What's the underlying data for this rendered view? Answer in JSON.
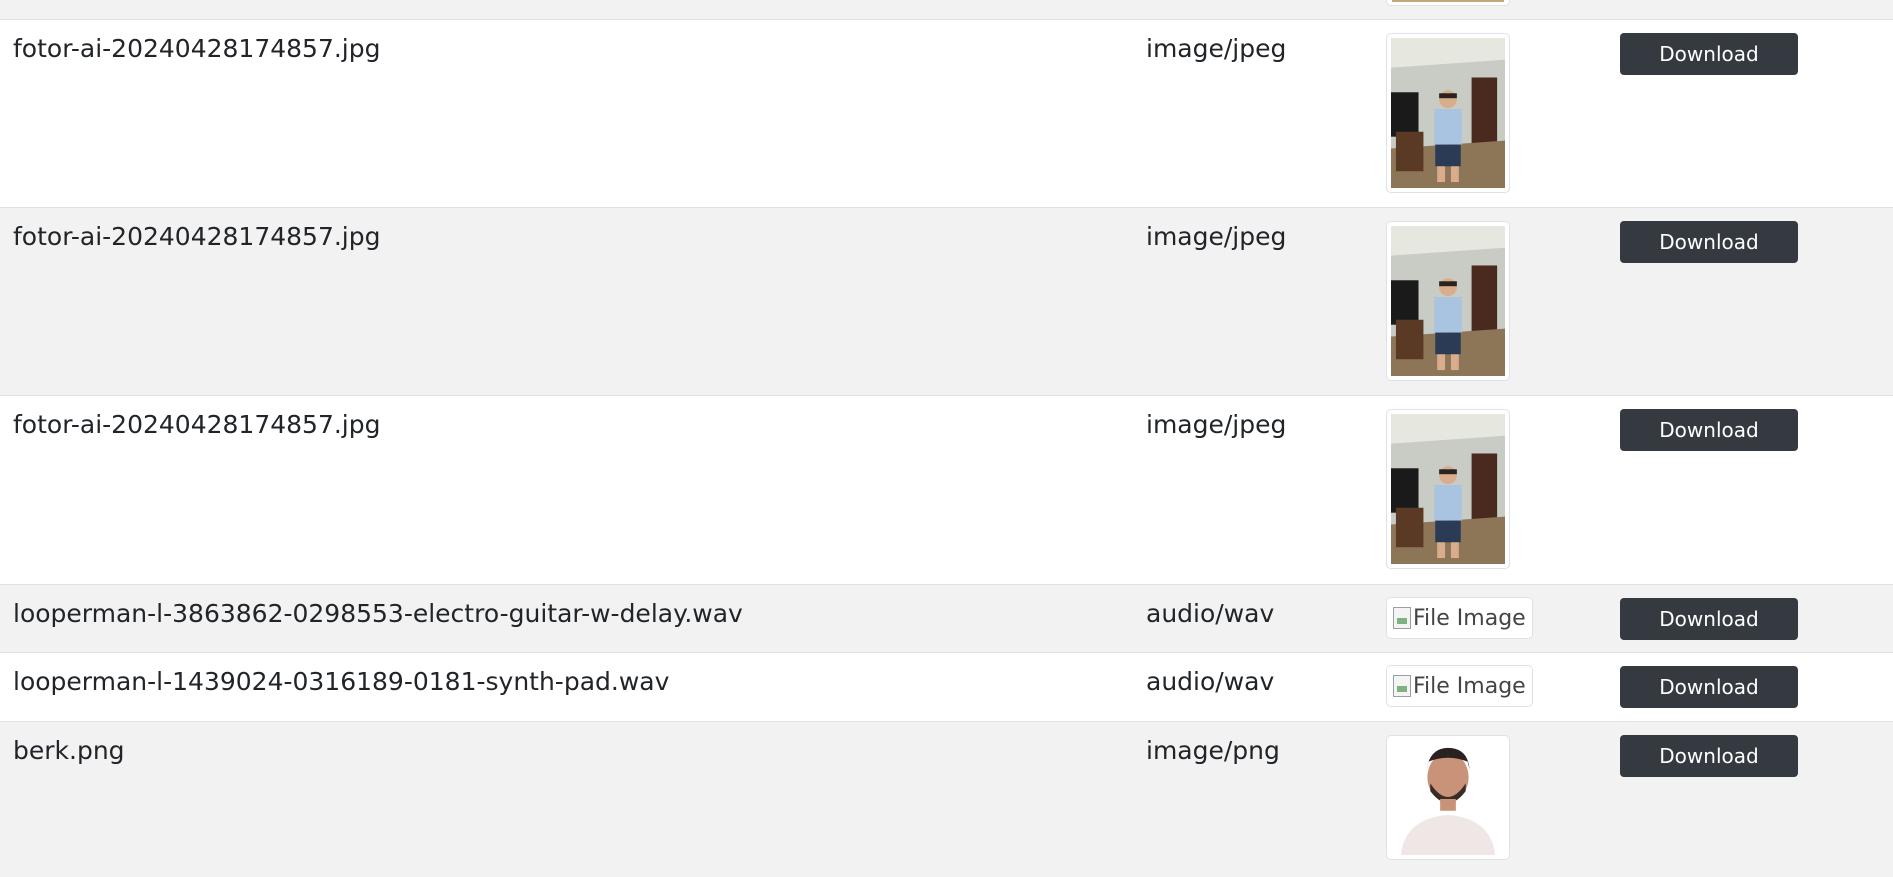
{
  "files": [
    {
      "name": "fotor-ai-20240428174857.jpg",
      "type": "image/jpeg",
      "preview": "photo",
      "preview_alt": "",
      "button": "Download"
    },
    {
      "name": "fotor-ai-20240428174857.jpg",
      "type": "image/jpeg",
      "preview": "photo",
      "preview_alt": "",
      "button": "Download"
    },
    {
      "name": "fotor-ai-20240428174857.jpg",
      "type": "image/jpeg",
      "preview": "photo",
      "preview_alt": "",
      "button": "Download"
    },
    {
      "name": "looperman-l-3863862-0298553-electro-guitar-w-delay.wav",
      "type": "audio/wav",
      "preview": "broken",
      "preview_alt": "File Image",
      "button": "Download"
    },
    {
      "name": "looperman-l-1439024-0316189-0181-synth-pad.wav",
      "type": "audio/wav",
      "preview": "broken",
      "preview_alt": "File Image",
      "button": "Download"
    },
    {
      "name": "berk.png",
      "type": "image/png",
      "preview": "portrait",
      "preview_alt": "",
      "button": "Download"
    }
  ],
  "colors": {
    "button_bg": "#343a40",
    "stripe": "#f2f2f2",
    "border": "#dee2e6"
  }
}
